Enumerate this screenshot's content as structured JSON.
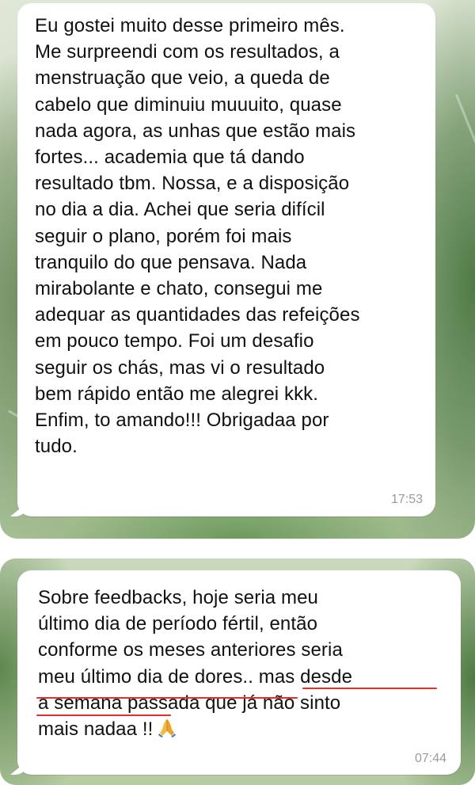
{
  "messages": [
    {
      "text": "Eu gostei muito desse primeiro mês.\nMe surpreendi com os resultados, a\nmenstruação que veio, a queda de\ncabelo que diminuiu muuuito, quase\nnada agora, as unhas que estão mais\nfortes... academia que tá dando\nresultado tbm. Nossa, e a disposição\nno dia a dia. Achei que seria difícil\nseguir o plano, porém foi mais\ntranquilo do que pensava. Nada\nmirabolante e chato, consegui me\nadequar as quantidades das refeições\nem pouco tempo. Foi um desafio\nseguir os chás, mas vi o resultado\nbem rápido então me alegrei kkk.\nEnfim, to amando!!! Obrigadaa por\ntudo.",
      "time": "17:53"
    },
    {
      "text": "Sobre feedbacks, hoje seria meu\núltimo dia de período fértil, então\nconforme os meses anteriores seria\nmeu último dia de dores.. mas desde\na semana passada que já não sinto\nmais nadaa !!",
      "emoji": "folded-hands-icon",
      "time": "07:44"
    }
  ],
  "colors": {
    "bubble": "#ffffff",
    "text": "#111111",
    "timestamp": "#9a9a9a",
    "annotation": "#e0322c",
    "wallpaper": "#a9c196"
  }
}
